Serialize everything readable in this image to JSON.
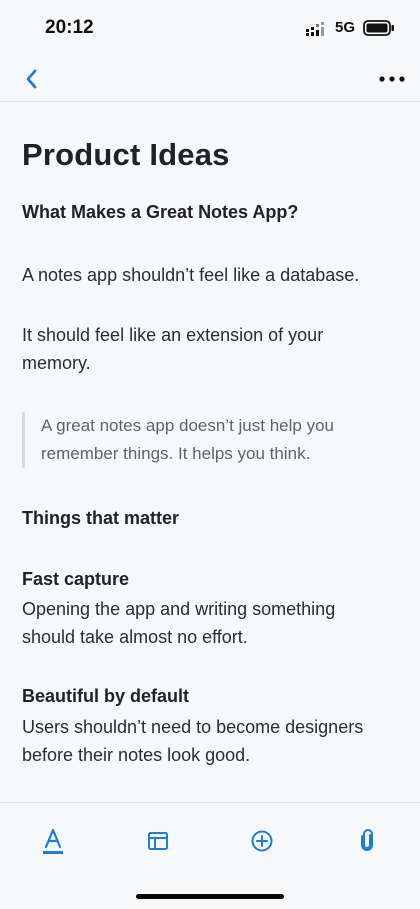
{
  "status": {
    "time": "20:12",
    "network": "5G"
  },
  "nav": {
    "back_icon": "chevron-left-icon",
    "more_icon": "more-horizontal-icon"
  },
  "note": {
    "title": "Product Ideas",
    "heading": "What Makes a Great Notes App?",
    "paragraph1": "A notes app shouldn’t feel like a database.",
    "paragraph2_line1": "It should feel like an extension of your",
    "paragraph2_line2": "memory.",
    "quote_line1": "A great notes app doesn’t just help you",
    "quote_line2": "remember things. It helps you think.",
    "section_heading": "Things that matter",
    "items": [
      {
        "title": "Fast capture",
        "line1": "Opening the app and writing something",
        "line2": "should take almost no effort."
      },
      {
        "title": "Beautiful by default",
        "line1": "Users shouldn’t need to become designers",
        "line2": "before their notes look good."
      }
    ]
  },
  "toolbar": {
    "icons": [
      "text-format-icon",
      "table-icon",
      "add-circle-icon",
      "attachment-icon"
    ],
    "accent": "#1c7ed6"
  }
}
